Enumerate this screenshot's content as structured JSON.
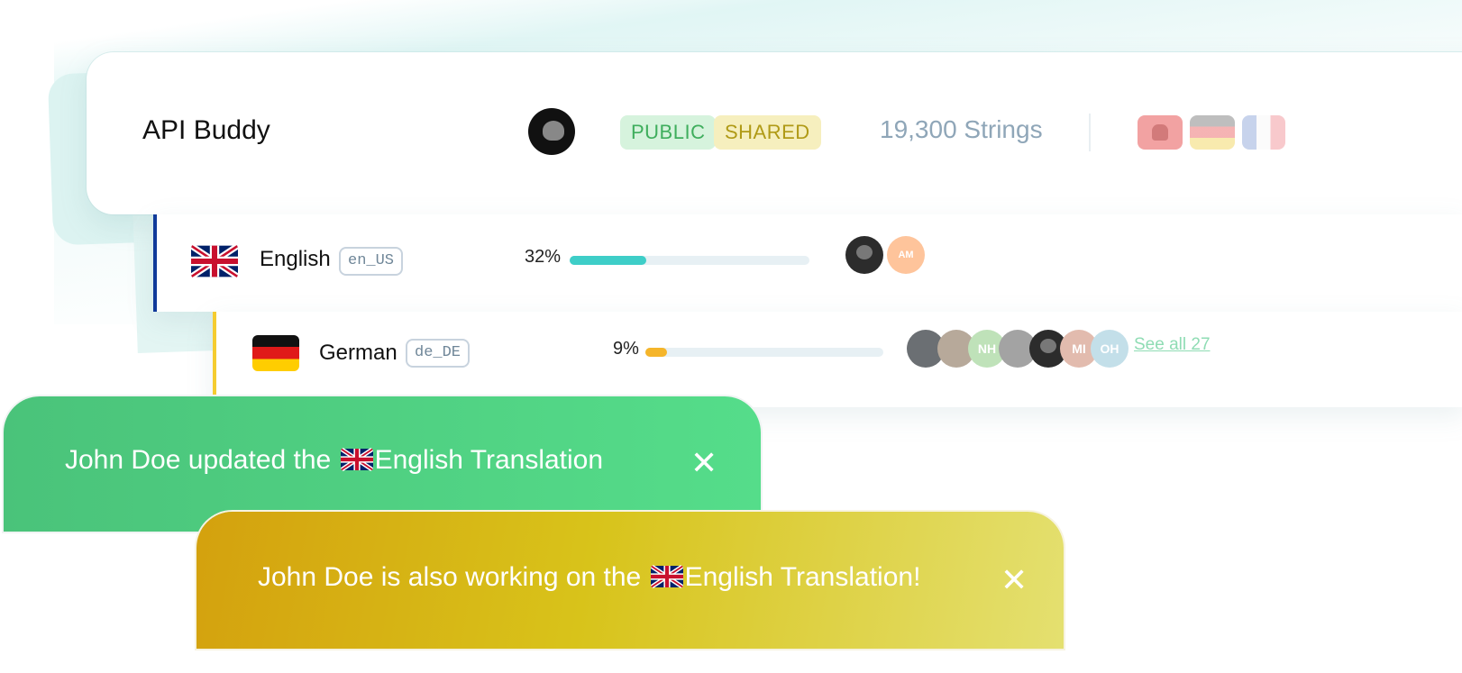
{
  "project": {
    "name": "API Buddy",
    "visibility_badge": "PUBLIC",
    "sharing_badge": "SHARED",
    "strings_count": "19,300 Strings",
    "language_flags": [
      "albania-flag-icon",
      "germany-flag-icon",
      "france-flag-icon"
    ]
  },
  "languages": [
    {
      "name": "English",
      "locale": "en_US",
      "progress_label": "32%",
      "progress": 0.32,
      "accent": "#103a9a",
      "contributors": [
        {
          "initials": ""
        },
        {
          "initials": "AM"
        }
      ]
    },
    {
      "name": "German",
      "locale": "de_DE",
      "progress_label": "9%",
      "progress": 0.09,
      "accent": "#f5cc30",
      "contributors": [
        {
          "initials": ""
        },
        {
          "initials": ""
        },
        {
          "initials": "NH"
        },
        {
          "initials": ""
        },
        {
          "initials": ""
        },
        {
          "initials": "MI"
        },
        {
          "initials": "OH"
        }
      ],
      "see_all": "See all 27"
    }
  ],
  "toasts": [
    {
      "prefix": "John Doe updated the ",
      "flag": "uk-flag-icon",
      "suffix": "English Translation",
      "color": "#4ac37a"
    },
    {
      "prefix": "John Doe is also working on the ",
      "flag": "uk-flag-icon",
      "suffix": "English Translation!",
      "color": "#d4a10e"
    }
  ],
  "colors": {
    "public_badge": "#3fae5d",
    "shared_badge": "#b09a16",
    "english_bar": "#3ecec8",
    "german_bar": "#f5b52a"
  }
}
